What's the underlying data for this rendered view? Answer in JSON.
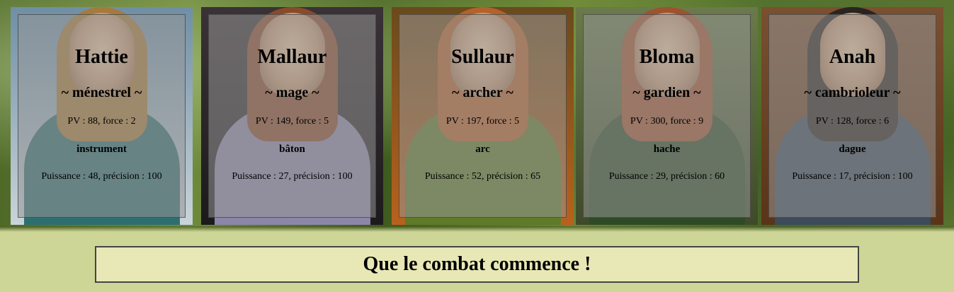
{
  "characters": [
    {
      "name": "Hattie",
      "class": "~ ménestrel ~",
      "stats": "PV : 88, force : 2",
      "weapon": "instrument",
      "weapon_stats": "Puissance : 48, précision : 100",
      "colors": {
        "bg": "#6f8fa6",
        "frame": "#c9d4d9",
        "hair": "#a67a3a",
        "body": "#2f6e70"
      }
    },
    {
      "name": "Mallaur",
      "class": "~ mage ~",
      "stats": "PV : 149, force : 5",
      "weapon": "bâton",
      "weapon_stats": "Puissance : 27, précision : 100",
      "colors": {
        "bg": "#3a3236",
        "frame": "#1c1a1c",
        "hair": "#8a4a2a",
        "body": "#8c86a8"
      }
    },
    {
      "name": "Sullaur",
      "class": "~ archer ~",
      "stats": "PV : 197, force : 5",
      "weapon": "arc",
      "weapon_stats": "Puissance : 52, précision : 65",
      "colors": {
        "bg": "#6b4a1c",
        "frame": "#b8611c",
        "hair": "#b5612a",
        "body": "#5f7a28"
      }
    },
    {
      "name": "Bloma",
      "class": "~ gardien ~",
      "stats": "PV : 300, force : 9",
      "weapon": "hache",
      "weapon_stats": "Puissance : 29, précision : 60",
      "colors": {
        "bg": "#6a7a4a",
        "frame": "#3e4a2a",
        "hair": "#a0522d",
        "body": "#2f4a26"
      }
    },
    {
      "name": "Anah",
      "class": "~ cambrioleur ~",
      "stats": "PV : 128, force : 6",
      "weapon": "dague",
      "weapon_stats": "Puissance : 17, précision : 100",
      "colors": {
        "bg": "#7a5030",
        "frame": "#5a3418",
        "hair": "#2a2420",
        "body": "#3c4a5a"
      }
    }
  ],
  "start_button_label": "Que le combat commence !",
  "colors": {
    "page_bg": "#cdd597",
    "button_bg": "#e8e8b6",
    "button_border": "#444444",
    "card_overlay": "rgba(150,150,150,0.55)"
  }
}
